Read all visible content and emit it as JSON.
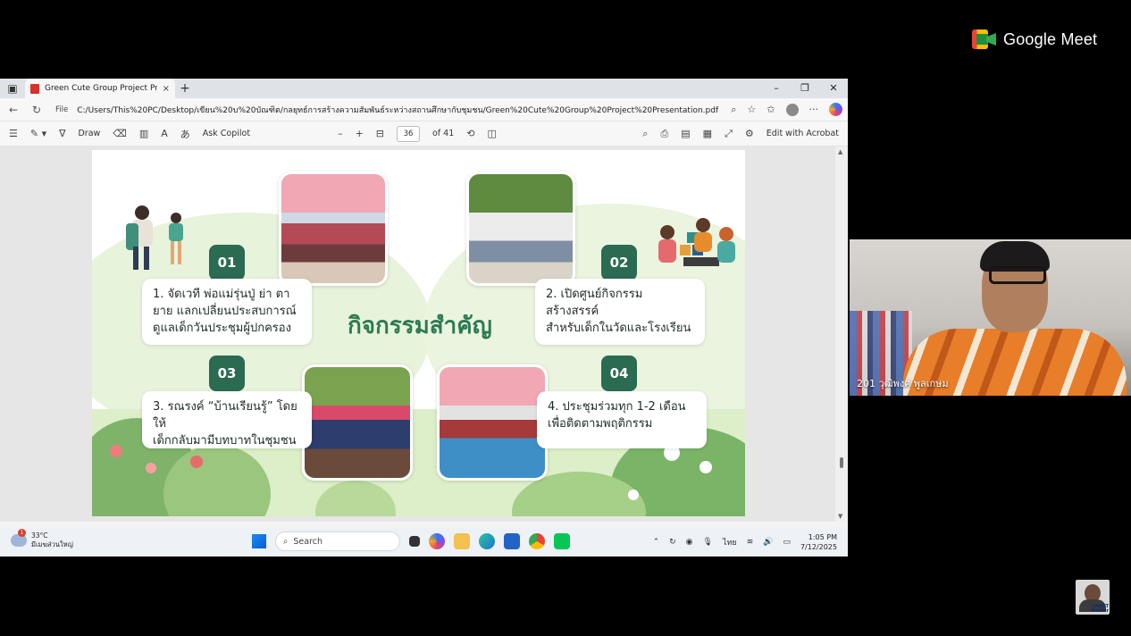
{
  "meet": {
    "brand": "Google Meet"
  },
  "browser": {
    "tab_title": "Green Cute Group Project Presen",
    "close_tab": "×",
    "new_tab": "+",
    "window_controls": [
      "–",
      "❐",
      "✕"
    ],
    "address": {
      "scheme_label": "File",
      "url": "C:/Users/This%20PC/Desktop/เขียน%20บ%20บัณฑิต/กลยุทธ์การสร้างความสัมพันธ์ระหว่างสถานศึกษากับชุมชน/Green%20Cute%20Group%20Project%20Presentation.pdf"
    },
    "pdf_toolbar": {
      "draw_label": "Draw",
      "ask_copilot": "Ask Copilot",
      "zoom_out": "–",
      "zoom_in": "+",
      "page_current": "36",
      "page_total": "of 41",
      "edit_with_acrobat": "Edit with Acrobat"
    }
  },
  "slide": {
    "title": "กิจกรรมสำคัญ",
    "items": [
      {
        "number": "01",
        "text_line1": "1. จัดเวที พ่อแม่รุ่นปู่ ย่า ตา",
        "text_line2": "ยาย แลกเปลี่ยนประสบการณ์",
        "text_line3": "ดูแลเด็กวันประชุมผู้ปกครอง"
      },
      {
        "number": "02",
        "text_line1": "2. เปิดศูนย์กิจกรรมสร้างสรรค์",
        "text_line2": "สำหรับเด็กในวัดและโรงเรียน"
      },
      {
        "number": "03",
        "text_line1": "3. รณรงค์ “บ้านเรียนรู้” โดยให้",
        "text_line2": "เด็กกลับมามีบทบาทในชุมชน"
      },
      {
        "number": "04",
        "text_line1": "4. ประชุมร่วมทุก 1-2 เดือน",
        "text_line2": "เพื่อติดตามพฤติกรรม"
      }
    ]
  },
  "taskbar": {
    "weather_temp": "33°C",
    "weather_desc": "มีเมฆส่วนใหญ่",
    "weather_alert": "1",
    "search_placeholder": "Search",
    "language": "ไทย",
    "time": "1:05 PM",
    "date": "7/12/2025"
  },
  "participant": {
    "name": "201 วุฒิพงศ์ พูลเกษม"
  },
  "self_view": {
    "tag": "CHART Master"
  },
  "colors": {
    "badge": "#2a6b52",
    "title": "#2e7a55",
    "taskbar": "#eef1f6"
  }
}
